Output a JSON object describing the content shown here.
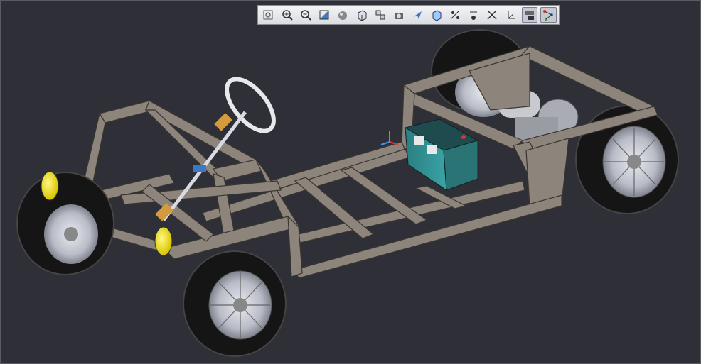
{
  "viewer": {
    "background": "#2f3037",
    "toolbar_tools": [
      {
        "icon": "fit-all-icon",
        "active": false
      },
      {
        "icon": "zoom-in-icon",
        "active": false
      },
      {
        "icon": "zoom-out-icon",
        "active": false
      },
      {
        "icon": "normal-view-icon",
        "active": false
      },
      {
        "icon": "shading-icon",
        "active": false
      },
      {
        "icon": "iso-view-icon",
        "active": false
      },
      {
        "icon": "multi-view-icon",
        "active": false
      },
      {
        "icon": "capture-icon",
        "active": false
      },
      {
        "icon": "fly-mode-icon",
        "active": false
      },
      {
        "icon": "cube-view-icon",
        "active": false
      },
      {
        "icon": "hide-show-icon",
        "active": false
      },
      {
        "icon": "swap-visible-icon",
        "active": false
      },
      {
        "icon": "hide-icon",
        "active": false
      },
      {
        "icon": "axis-icon",
        "active": false
      },
      {
        "icon": "selection-icon",
        "active": true
      },
      {
        "icon": "tree-icon",
        "active": true
      }
    ]
  },
  "colors": {
    "frame": "#8d857c",
    "frame_dark": "#5a544e",
    "tire": "#1a1a1a",
    "rim": "#b9bcc6",
    "battery": "#2f8c8f",
    "headlight": "#f1e21a",
    "steering_joint": "#d49a3c"
  }
}
